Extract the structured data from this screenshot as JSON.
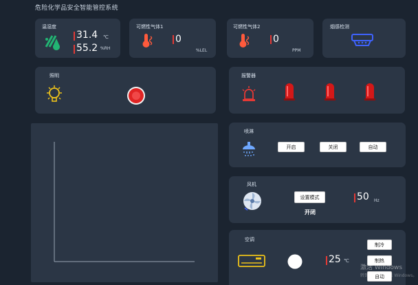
{
  "app": {
    "title": "危险化学品安全智能管控系统"
  },
  "cards": {
    "humidity": {
      "label": "温湿度",
      "temp_value": "31.4",
      "temp_unit": "℃",
      "hum_value": "55.2",
      "hum_unit": "%RH"
    },
    "gas1": {
      "label": "可燃性气体1",
      "value": "0",
      "unit": "%LEL"
    },
    "gas2": {
      "label": "可燃性气体2",
      "value": "0",
      "unit": "PPM"
    },
    "smoke": {
      "label": "烟感检测"
    },
    "lighting": {
      "label": "照明"
    },
    "alarm": {
      "label": "报警器"
    },
    "sprinkler": {
      "label": "喷淋",
      "buttons": [
        "开启",
        "关闭",
        "自动"
      ]
    },
    "fan": {
      "label": "风机",
      "mode_button": "设置模式",
      "status": "开闭",
      "value": "50",
      "unit": "Hz"
    },
    "ac": {
      "label": "空调",
      "value": "25",
      "unit": "℃",
      "buttons": [
        "制冷",
        "制热",
        "自动"
      ]
    }
  },
  "watermark": {
    "line1": "激活 Windows",
    "line2": "转到\"设置\"以激活 Windows。"
  },
  "colors": {
    "background": "#1b2430",
    "card": "#2b3645",
    "accent_red": "#e53935",
    "icon_green": "#22b573",
    "icon_yellow": "#f0c419",
    "icon_blue": "#3f63ff",
    "icon_orange": "#ff5a3c"
  }
}
